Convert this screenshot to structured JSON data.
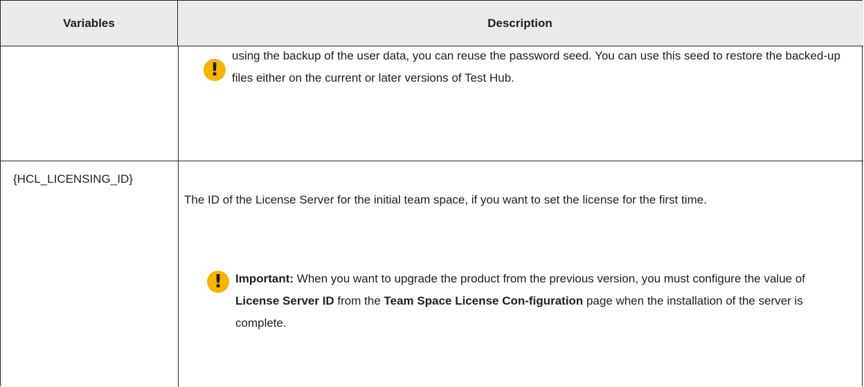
{
  "table": {
    "headers": {
      "variables": "Variables",
      "description": "Description"
    },
    "row1": {
      "variable": "",
      "note_continuation": "using the backup of the user data, you can reuse the password seed. You can use this seed to restore the backed-up files either on the current or later versions of Test Hub."
    },
    "row2": {
      "variable": "{HCL_LICENSING_ID}",
      "description": "The ID of the License Server for the initial team space, if you want to set the license for the first time.",
      "note": {
        "label": "Important:",
        "text_1": " When you want to upgrade the product from the previous version, you must configure the value of ",
        "bold_1": "License Server ID",
        "text_2": " from the ",
        "bold_2": "Team Space License Con-figuration",
        "text_3": " page when the installation of the server is complete."
      }
    }
  },
  "icons": {
    "warning_glyph": "!",
    "warning_color": "#f4b400"
  }
}
